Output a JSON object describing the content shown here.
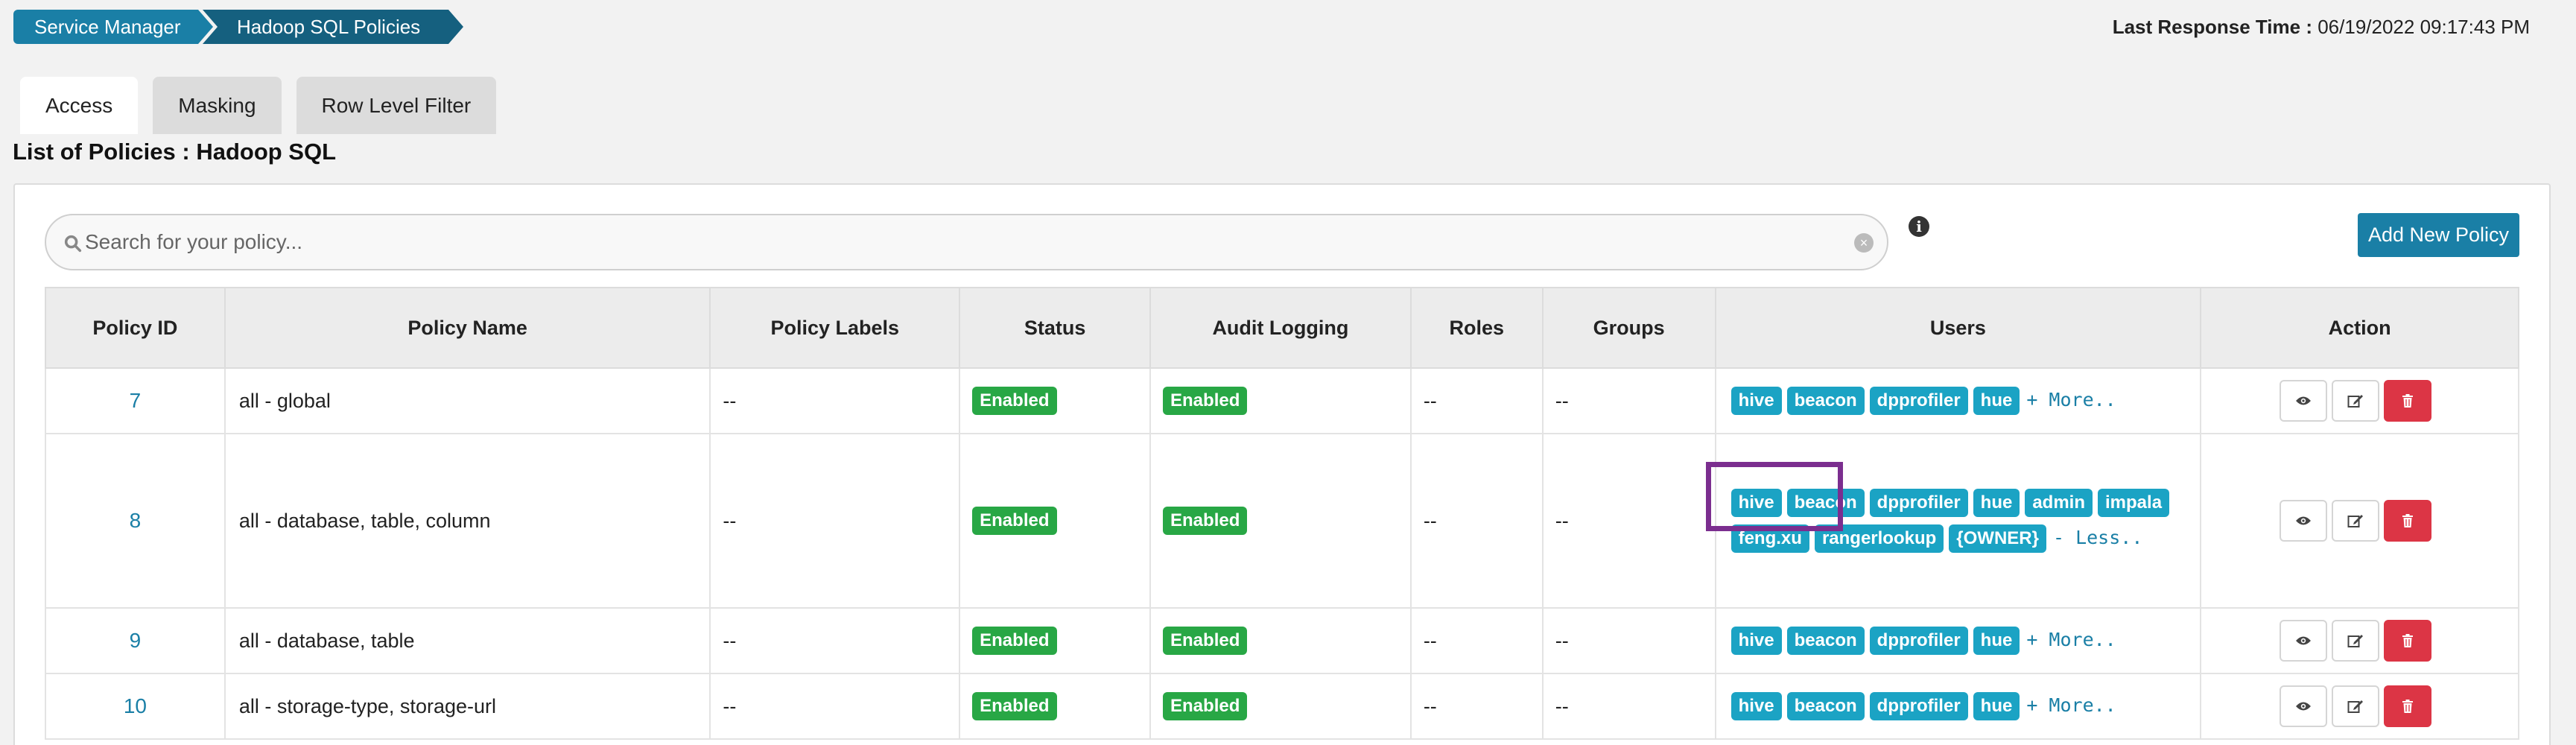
{
  "breadcrumb": [
    "Service Manager",
    "Hadoop SQL Policies"
  ],
  "response_time": {
    "label": "Last Response Time :",
    "value": "06/19/2022 09:17:43 PM"
  },
  "tabs": [
    {
      "label": "Access",
      "active": true
    },
    {
      "label": "Masking",
      "active": false
    },
    {
      "label": "Row Level Filter",
      "active": false
    }
  ],
  "list_title": "List of Policies : Hadoop SQL",
  "search": {
    "placeholder": "Search for your policy..."
  },
  "add_button": "Add New Policy",
  "columns": [
    "Policy ID",
    "Policy Name",
    "Policy Labels",
    "Status",
    "Audit Logging",
    "Roles",
    "Groups",
    "Users",
    "Action"
  ],
  "rows": [
    {
      "id": "7",
      "name": "all - global",
      "labels": "--",
      "status": "Enabled",
      "audit": "Enabled",
      "roles": "--",
      "groups": "--",
      "users_line1": [
        "hive",
        "beacon",
        "dpprofiler",
        "hue"
      ],
      "users_line2": [],
      "toggle": "+ More.."
    },
    {
      "id": "8",
      "name": "all - database, table, column",
      "labels": "--",
      "status": "Enabled",
      "audit": "Enabled",
      "roles": "--",
      "groups": "--",
      "users_line1": [
        "hive",
        "beacon",
        "dpprofiler",
        "hue",
        "admin",
        "impala"
      ],
      "users_line2": [
        "feng.xu",
        "rangerlookup",
        "{OWNER}"
      ],
      "toggle": "- Less.."
    },
    {
      "id": "9",
      "name": "all - database, table",
      "labels": "--",
      "status": "Enabled",
      "audit": "Enabled",
      "roles": "--",
      "groups": "--",
      "users_line1": [
        "hive",
        "beacon",
        "dpprofiler",
        "hue"
      ],
      "users_line2": [],
      "toggle": "+ More.."
    },
    {
      "id": "10",
      "name": "all - storage-type, storage-url",
      "labels": "--",
      "status": "Enabled",
      "audit": "Enabled",
      "roles": "--",
      "groups": "--",
      "users_line1": [
        "hive",
        "beacon",
        "dpprofiler",
        "hue"
      ],
      "users_line2": [],
      "toggle": "+ More.."
    }
  ],
  "icons": {
    "view": "eye-icon",
    "edit": "edit-icon",
    "delete": "trash-icon",
    "search": "search-icon",
    "info": "info-icon"
  },
  "colors": {
    "primary": "#1a7fa6",
    "enabled": "#28a745",
    "user_badge": "#1ba3c4",
    "delete": "#dc3545",
    "highlight": "#7b2e8f"
  }
}
